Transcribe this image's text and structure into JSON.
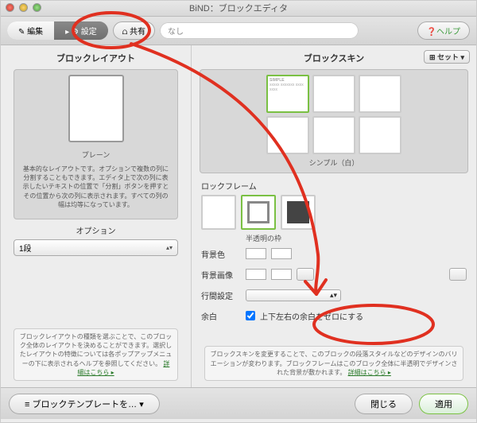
{
  "window": {
    "title": "BiND：ブロックエディタ"
  },
  "toolbar": {
    "edit": "✎ 編集",
    "settings": "▸ ⚙ 設定",
    "share_label": "⩍ 共有",
    "share_value": "なし",
    "help": "❓ヘルプ"
  },
  "left": {
    "title": "ブロックレイアウト",
    "thumb_caption": "プレーン",
    "description": "基本的なレイアウトです。オプションで複数の列に分割することもできます。エディタ上で次の列に表示したいテキストの位置で「分割」ボタンを押すとその位置から次の列に表示されます。すべての列の幅は均等になっています。",
    "option_label": "オプション",
    "option_value": "1段",
    "help": "ブロックレイアウトの種類を選ぶことで、このブロック全体のレイアウトを決めることができます。選択したレイアウトの特徴については各ポップアップメニューの下に表示されるヘルプを参照してください。",
    "help_link": "詳細はこちら ▸"
  },
  "right": {
    "title": "ブロックスキン",
    "set_button": "⊞ セット ▾",
    "skin_simple": "SIMPLE",
    "skin_caption": "シンプル（白）",
    "frame_label": "ロックフレーム",
    "frame_caption": "半透明の枠",
    "bgcolor_label": "背景色",
    "bgimage_label": "背景画像",
    "line_label": "行間設定",
    "margin_label": "余白",
    "margin_checkbox": "上下左右の余白をゼロにする",
    "help": "ブロックスキンを変更することで、このブロックの段落スタイルなどのデザインのバリエーションが変わります。ブロックフレームはこのブロック全体に半透明でデザインされた背景が敷かれます。",
    "help_link": "詳細はこちら ▸"
  },
  "footer": {
    "template": "≡ ブロックテンプレートを… ▾",
    "close": "閉じる",
    "apply": "適用"
  },
  "annotation_color": "#e03020"
}
